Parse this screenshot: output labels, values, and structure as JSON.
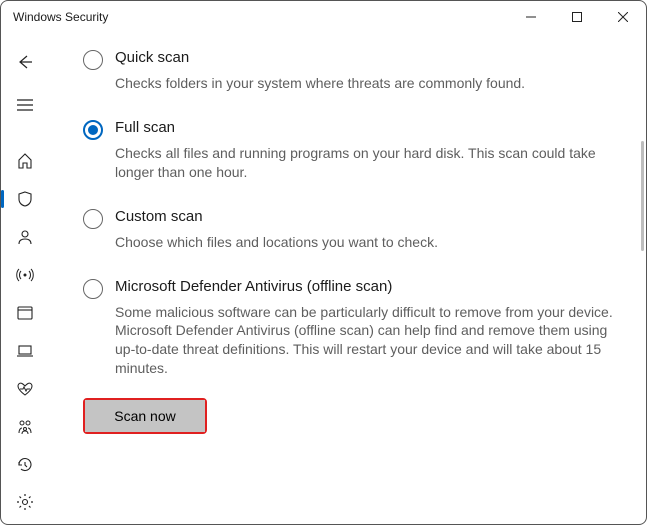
{
  "window": {
    "title": "Windows Security"
  },
  "options": {
    "quick": {
      "title": "Quick scan",
      "desc": "Checks folders in your system where threats are commonly found."
    },
    "full": {
      "title": "Full scan",
      "desc": "Checks all files and running programs on your hard disk. This scan could take longer than one hour."
    },
    "custom": {
      "title": "Custom scan",
      "desc": "Choose which files and locations you want to check."
    },
    "offline": {
      "title": "Microsoft Defender Antivirus (offline scan)",
      "desc": "Some malicious software can be particularly difficult to remove from your device. Microsoft Defender Antivirus (offline scan) can help find and remove them using up-to-date threat definitions. This will restart your device and will take about 15 minutes."
    }
  },
  "actions": {
    "scan_now": "Scan now"
  },
  "selected_option": "full"
}
